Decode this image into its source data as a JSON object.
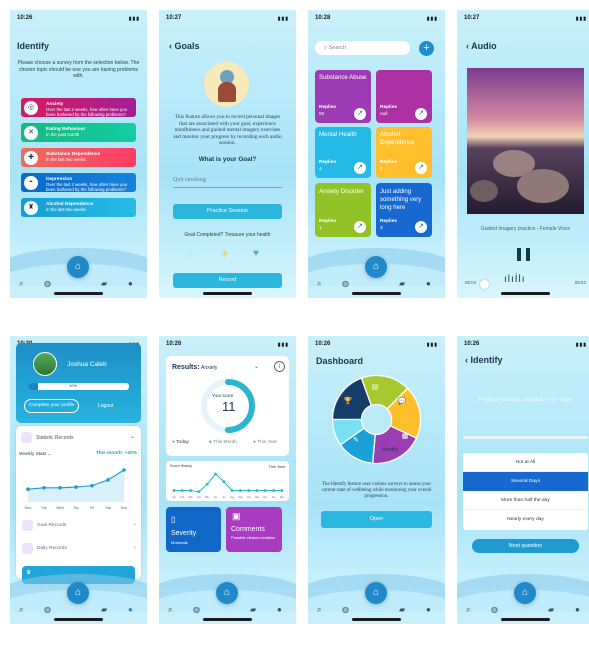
{
  "time": {
    "a": "10:26",
    "b": "10:27",
    "c": "10:28",
    "d": "10:27",
    "e": "10:30",
    "f": "10:26",
    "g": "10:26",
    "h": "10:26"
  },
  "screen1": {
    "title": "Identify",
    "intro": "Please choose a survey from the selection below. The chosen topic should be one you are having problems with.",
    "items": [
      {
        "title": "Anxiety",
        "text": "Over the last 2 weeks, how often have you been bothered by the following problems?"
      },
      {
        "title": "Eating Behaviour",
        "text": "In the past month"
      },
      {
        "title": "Substance Dependence",
        "text": "In the last two weeks"
      },
      {
        "title": "Depression",
        "text": "Over the last 2 weeks, how often have you been bothered by the following problems?"
      },
      {
        "title": "Alcohol Dependence",
        "text": "In the last two weeks"
      }
    ],
    "colors": [
      "#d81b60",
      "#19b77f",
      "#ef6b5b",
      "#0d68c7",
      "#1aa2d8"
    ]
  },
  "screen2": {
    "title": "Goals",
    "body": "This feature allows you to record personal images that are associated with your goal, experience mindfulness and guided mental imagery exercises and monitor your progress by recording each audio session.",
    "question": "What is your Goal?",
    "goal": "Quit smoking",
    "practice_label": "Practice Session",
    "completed": "Goal Completed? Treasure your health",
    "record_label": "Record"
  },
  "screen3": {
    "search_placeholder": "Search",
    "cards": [
      {
        "title": "Substance Abuse",
        "replies": "Replies",
        "count": "92"
      },
      {
        "title": "",
        "replies": "Replies",
        "count": "null"
      },
      {
        "title": "Mental Health",
        "replies": "Replies",
        "count": "4"
      },
      {
        "title": "Alcohol Dependence",
        "replies": "Replies",
        "count": "2"
      },
      {
        "title": "Anxiety Disorder",
        "replies": "Replies",
        "count": "1"
      },
      {
        "title": "Just adding something very long here",
        "replies": "Replies",
        "count": "3"
      }
    ],
    "colors": [
      "#9d3bb4",
      "#ac31a5",
      "#25b9e5",
      "#ffbf2d",
      "#91c326",
      "#1769d0"
    ]
  },
  "screen4": {
    "title": "Audio",
    "caption": "Guided Imagery practice - Female Voice",
    "start": "00:04",
    "end": "08:52"
  },
  "screen5": {
    "name": "Joshua Caleb",
    "progress": "10%",
    "progress_value": 0.1,
    "complete_profile": "Complete your profile",
    "logout": "Logout",
    "statistic_records": "Statistic Records",
    "weekly_stats": "Weekly Stats",
    "this_month": "This month: +20%",
    "days": [
      "Mon",
      "Tue",
      "Wed",
      "Thu",
      "Fri",
      "Sat",
      "Sun"
    ],
    "weekly_values": [
      18,
      20,
      20,
      21,
      23,
      31,
      45
    ],
    "goal_records": "Goal Records",
    "daily_records": "Daily Records"
  },
  "screen6": {
    "results_label": "Results:",
    "results_value": "Anxiety",
    "your_score": "Your score",
    "score": "11",
    "score_fraction": 0.5,
    "legend": [
      "Today",
      "This Month",
      "This Year"
    ],
    "history_label": "Score History",
    "history_period": "This Year",
    "history_values": [
      2,
      2,
      2,
      1,
      7,
      15,
      9,
      2,
      2,
      2,
      2,
      2,
      2,
      2
    ],
    "history_ticks": [
      "Jan",
      "Feb",
      "Mar",
      "Apr",
      "May",
      "Jun",
      "Jul",
      "Aug",
      "Sep",
      "Oct",
      "Nov",
      "Dec",
      "Jan",
      "Feb"
    ],
    "severity_title": "Severity",
    "severity_value": "Moderate",
    "comments_title": "Comments",
    "comments_value": "Possible clinical condition"
  },
  "screen7": {
    "title": "Dashboard",
    "identify": "Identify",
    "body": "The Identify feature uses various surveys to assess your current state of wellbeing while monitoring your overall progression.",
    "open_label": "Open",
    "segment_colors": [
      "#153e6b",
      "#a6c92f",
      "#ffbf2d",
      "#9a3eb4",
      "#1aa2d8",
      "#78e0f1"
    ]
  },
  "screen8": {
    "title": "Identify",
    "question": "Feeling nervous, anxious or on edge",
    "options": [
      "Not at All",
      "Several Days",
      "More than half the day",
      "Nearly every day"
    ],
    "selected": "Several Days",
    "next_label": "Next question"
  }
}
